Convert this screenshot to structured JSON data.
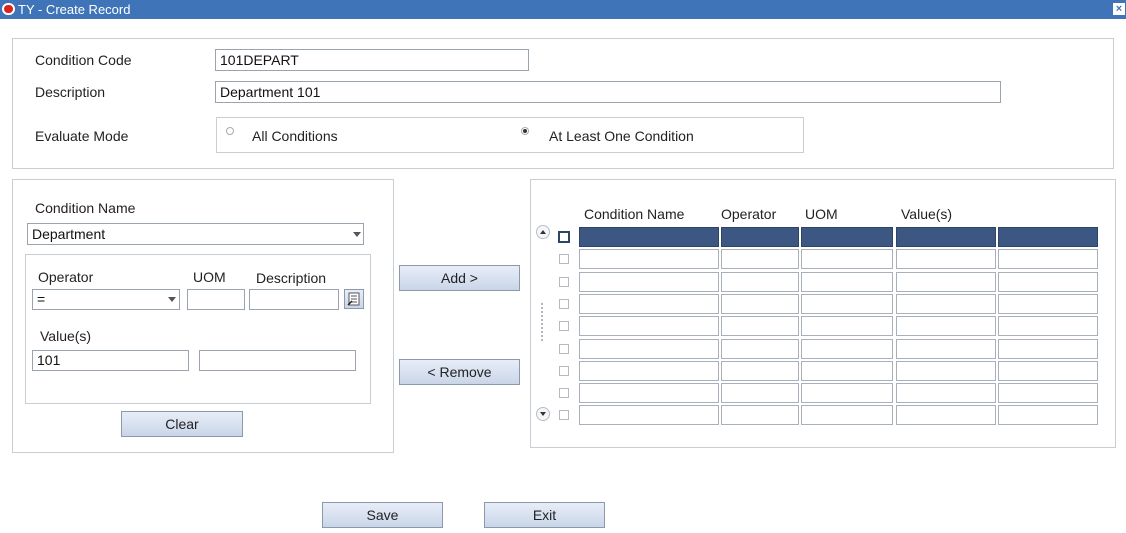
{
  "window": {
    "title": "TY - Create Record",
    "close_glyph": "×"
  },
  "header_form": {
    "condition_code": {
      "label": "Condition Code",
      "value": "101DEPART"
    },
    "description": {
      "label": "Description",
      "value": "Department 101"
    },
    "evaluate_mode": {
      "label": "Evaluate Mode",
      "options": [
        {
          "label": "All Conditions",
          "selected": false
        },
        {
          "label": "At Least One Condition",
          "selected": true
        }
      ]
    }
  },
  "condition_panel": {
    "condition_name": {
      "label": "Condition Name",
      "value": "Department"
    },
    "operator": {
      "label": "Operator",
      "value": "="
    },
    "uom": {
      "label": "UOM",
      "value": ""
    },
    "description": {
      "label": "Description",
      "value": ""
    },
    "values": {
      "label": "Value(s)",
      "value1": "101",
      "value2": ""
    },
    "clear_label": "Clear"
  },
  "actions": {
    "add_label": "Add >",
    "remove_label": "< Remove"
  },
  "conditions_table": {
    "columns": [
      "Condition Name",
      "Operator",
      "UOM",
      "Value(s)",
      ""
    ],
    "rows": [
      [
        "",
        "",
        "",
        "",
        ""
      ],
      [
        "",
        "",
        "",
        "",
        ""
      ],
      [
        "",
        "",
        "",
        "",
        ""
      ],
      [
        "",
        "",
        "",
        "",
        ""
      ],
      [
        "",
        "",
        "",
        "",
        ""
      ],
      [
        "",
        "",
        "",
        "",
        ""
      ],
      [
        "",
        "",
        "",
        "",
        ""
      ],
      [
        "",
        "",
        "",
        "",
        ""
      ],
      [
        "",
        "",
        "",
        "",
        ""
      ]
    ],
    "selected_row": 0
  },
  "footer": {
    "save_label": "Save",
    "exit_label": "Exit"
  },
  "icons": {
    "scroll_up": "scroll-up-icon",
    "scroll_down": "scroll-down-icon",
    "lov": "list-of-values-icon"
  }
}
